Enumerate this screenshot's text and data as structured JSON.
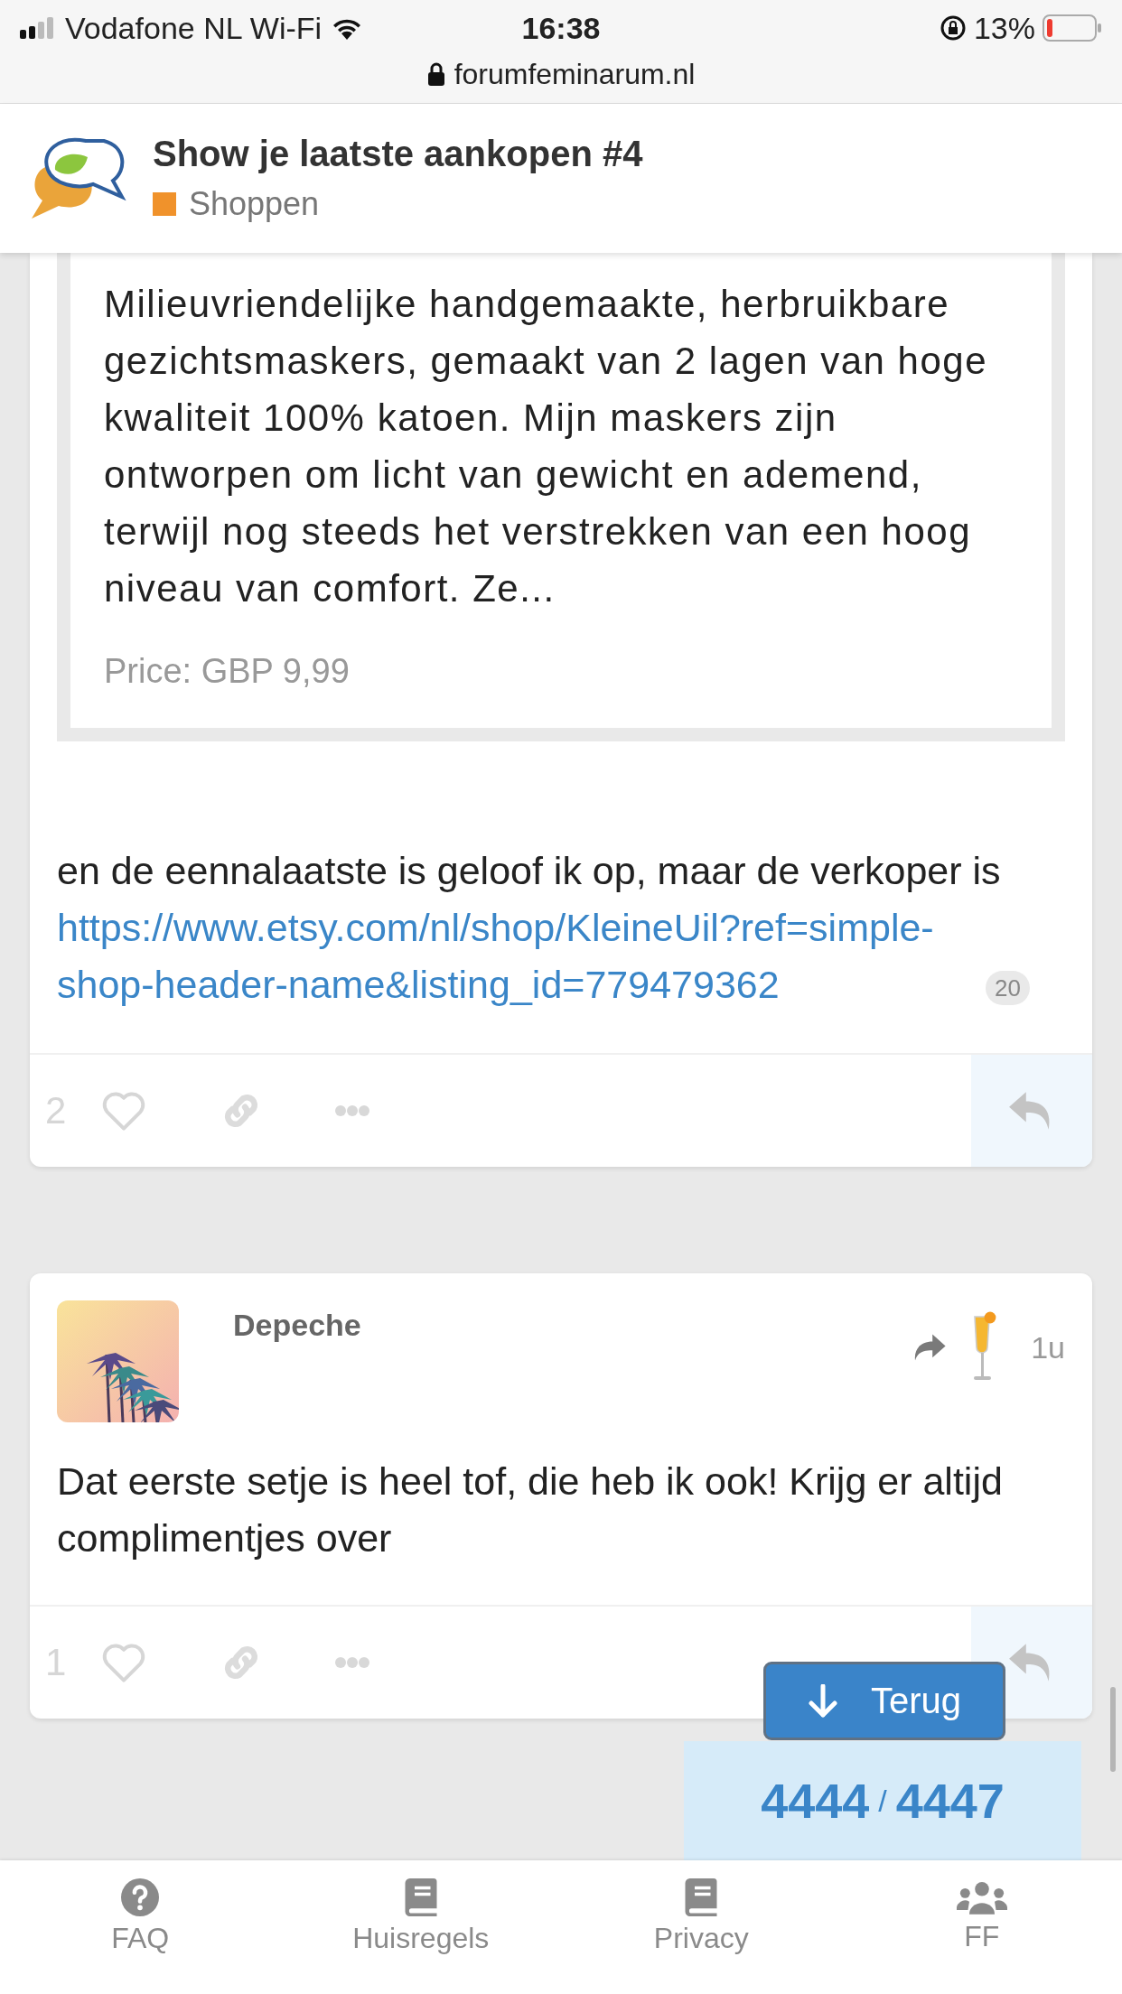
{
  "status_bar": {
    "carrier": "Vodafone NL Wi-Fi",
    "time": "16:38",
    "battery": "13%",
    "url": "forumfeminarum.nl"
  },
  "topic": {
    "title": "Show je laatste aankopen #4",
    "category": "Shoppen"
  },
  "posts": [
    {
      "kind": "continued",
      "onebox": {
        "description": "Milieuvriendelijke handgemaakte, herbruikbare gezichtsmaskers, gemaakt van 2 lagen van hoge kwaliteit 100% katoen. Mijn maskers zijn ontworpen om licht van gewicht en ademend, terwijl nog steeds het verstrekken van een hoog niveau van comfort. Ze...",
        "price": "Price: GBP 9,99"
      },
      "text": "en de eennalaatste is geloof ik op, maar de verkoper is",
      "link": "https://www.etsy.com/nl/shop/KleineUil?ref=simple-shop-header-name&listing_id=779479362",
      "link_clicks": "20",
      "likes": "2"
    },
    {
      "kind": "full",
      "author": "Depeche",
      "time": "1u",
      "text": "Dat eerste setje is heel tof, die heb ik ook! Krijg er altijd complimentjes over",
      "likes": "1"
    }
  ],
  "back_button": {
    "label": "Terug"
  },
  "progress": {
    "current": "4444",
    "separator": "/",
    "total": "4447"
  },
  "nav": [
    {
      "label": "FAQ",
      "kind": "help"
    },
    {
      "label": "Huisregels",
      "kind": "book"
    },
    {
      "label": "Privacy",
      "kind": "book"
    },
    {
      "label": "FF",
      "kind": "group"
    }
  ]
}
